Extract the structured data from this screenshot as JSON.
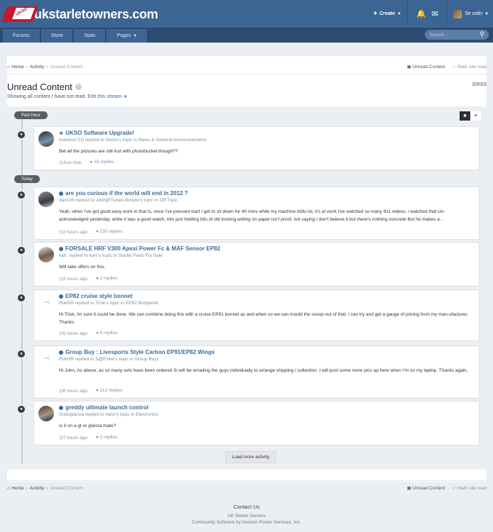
{
  "header": {
    "site_name": "ukstarletowners.com",
    "logo_badge": "UKSO",
    "create": "Create",
    "username": "5e colin"
  },
  "nav": {
    "tabs": [
      "Forums",
      "Store",
      "Stats",
      "Pages"
    ],
    "search_placeholder": "Search..."
  },
  "breadcrumb": {
    "home": "Home",
    "activity": "Activity",
    "current": "Unread Content",
    "unread_content": "Unread Content",
    "mark_read": "Mark site read"
  },
  "page": {
    "title": "Unread Content",
    "subtitle": "Showing all content I have not read.",
    "edit_stream": "Edit this stream",
    "rss": "RSS"
  },
  "groups": {
    "past_hour": "Past Hour",
    "today": "Today"
  },
  "items": [
    {
      "title": "UKSO Software Upgrade!",
      "author": "maddox71D",
      "action": "replied to",
      "owner": "Socks's",
      "topic_word": "topic in",
      "forum": "News & General Announcements",
      "snippet": "Bet all the pictures are still lost with photobucket though??",
      "time": "Just now",
      "replies": "19 replies"
    },
    {
      "title": "are you curious if the world will end in 2012 ?",
      "author": "dan106",
      "action": "replied to",
      "owner": "Josh@TunerLifestyle's",
      "topic_word": "topic in",
      "forum": "Off Topic",
      "snippet": "Yeah, when I've got good easy work in that is, once I've pressed start I get to sit down for 40 mins while my machine drills lol, it's at work I've watched so many 911 videos.    i watched that Un-acknowledged yesterday, while it was a good watch, him just holding bits of old looking writing on paper isn't proof, not saying I don't believe it but there's nothing concrete But he makes a...",
      "time": "3 hours ago",
      "replies": "150 replies"
    },
    {
      "title": "FORSALE HRF V300 Apexi Power Fc & MAF Sensor EP82",
      "author": "karl.",
      "action": "replied to",
      "owner": "karl.'s",
      "topic_word": "topic in",
      "forum": "Starlet Parts For Sale",
      "snippet": "Will take offers on this.",
      "time": "3 hours ago",
      "replies": "2 replies"
    },
    {
      "title": "EP82 cruise style bonnet",
      "author": "RobSR",
      "action": "replied to",
      "owner": "Trisk's",
      "topic_word": "topic in",
      "forum": "EP82 Bodywork",
      "snippet": "Hi Trisk, Im sure it could be done. We can combine doing this with a cruise EP91 bonnet as and when so we can mould the scoop out of that. I can try and get a gauge of pricing from my man-ufacturer. Thanks",
      "time": "6 hours ago",
      "replies": "6 replies"
    },
    {
      "title": "Group Buy : Livesports Style Carbon EP91/EP82 Wings",
      "author": "RobSR",
      "action": "replied to",
      "owner": "S@Fiske's",
      "topic_word": "topic in",
      "forum": "Group Buys",
      "snippet": "Hi John, As above, as so many sets have been ordered Si will be emailing the guys individually to arrange shipping / collection. I will post some more pics up here when I'm on my laptop. Thanks again,",
      "time": "6 hours ago",
      "replies": "112 replies"
    },
    {
      "title": "greddy ultimate launch control",
      "author": "Dudugianza",
      "action": "replied to",
      "owner": "nano's",
      "topic_word": "topic in",
      "forum": "Electronics",
      "snippet": "Is it on a gt or glanza mate?",
      "time": "7 hours ago",
      "replies": "2 replies"
    }
  ],
  "load_more": "Load more activity",
  "footer": {
    "contact": "Contact Us",
    "site": "UK Starlet Owners",
    "software": "Community Software by Invision Power Services, Inc."
  },
  "colors": {
    "header": "#3d6594",
    "navbar": "#2b4b6f",
    "link": "#3e6c96",
    "logo_red": "#c8182b"
  }
}
